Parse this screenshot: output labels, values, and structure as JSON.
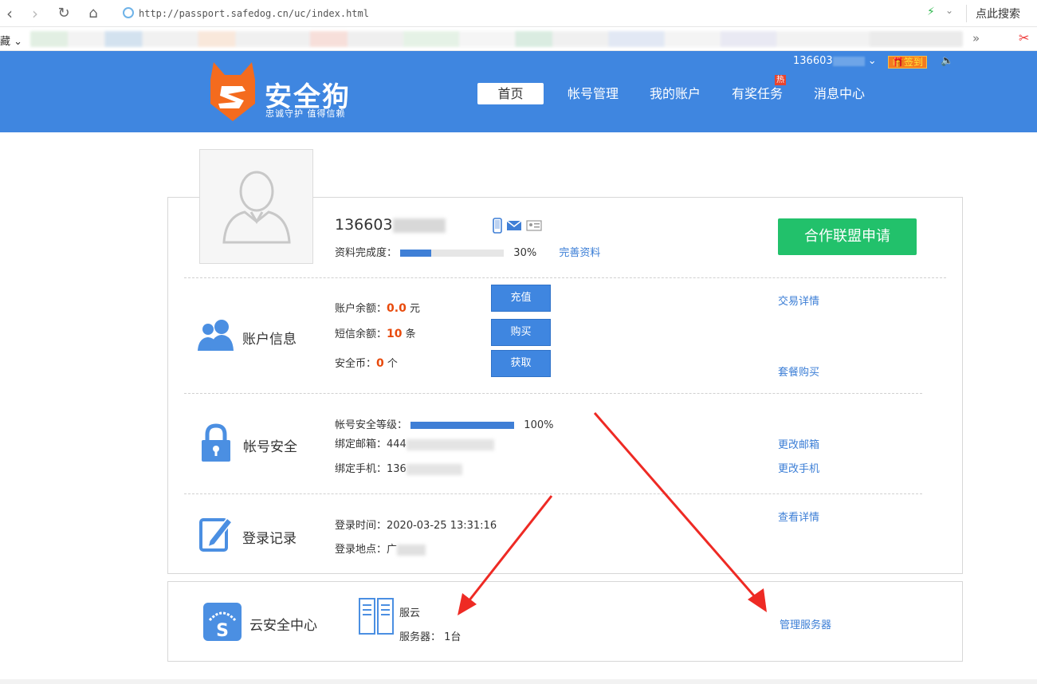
{
  "browser": {
    "url": "http://passport.safedog.cn/uc/index.html",
    "search_hint": "点此搜索",
    "favorites_label": "藏",
    "favorites_more": "»"
  },
  "header": {
    "brand": "安全狗",
    "slogan": "忠诚守护  值得信赖",
    "user": "136603",
    "signin": "签到",
    "hot_badge": "热",
    "nav": [
      "首页",
      "帐号管理",
      "我的账户",
      "有奖任务",
      "消息中心"
    ]
  },
  "profile": {
    "username": "136603",
    "completeness_label": "资料完成度：",
    "completeness_value": "30%",
    "completeness_fraction": 0.3,
    "complete_link": "完善资料",
    "alliance_button": "合作联盟申请"
  },
  "account": {
    "title": "账户信息",
    "balance_label": "账户余额：",
    "balance_value": "0.0",
    "balance_unit": "元",
    "sms_label": "短信余额：",
    "sms_value": "10",
    "sms_unit": "条",
    "coin_label": "安全币：",
    "coin_value": "0",
    "coin_unit": "个",
    "recharge_button": "充值",
    "buy_button": "购买",
    "get_button": "获取",
    "transactions_link": "交易详情",
    "package_link": "套餐购买"
  },
  "security": {
    "title": "帐号安全",
    "level_label": "帐号安全等级：",
    "level_value": "100%",
    "level_fraction": 1.0,
    "email_label": "绑定邮箱：",
    "email_value": "444",
    "phone_label": "绑定手机：",
    "phone_value": "136",
    "change_email_link": "更改邮箱",
    "change_phone_link": "更改手机"
  },
  "login": {
    "title": "登录记录",
    "time_label": "登录时间：",
    "time_value": "2020-03-25 13:31:16",
    "place_label": "登录地点：",
    "place_value": "广",
    "details_link": "查看详情"
  },
  "cloud": {
    "title": "云安全中心",
    "service": "服云",
    "server_label": "服务器：",
    "server_value": "1台",
    "manage_link": "管理服务器"
  },
  "colors": {
    "header_bg": "#3f86e0",
    "accent_green": "#22c16b",
    "link_blue": "#3b7ed6",
    "value_red": "#e84a0c",
    "arrow_red": "#ee2a24"
  }
}
